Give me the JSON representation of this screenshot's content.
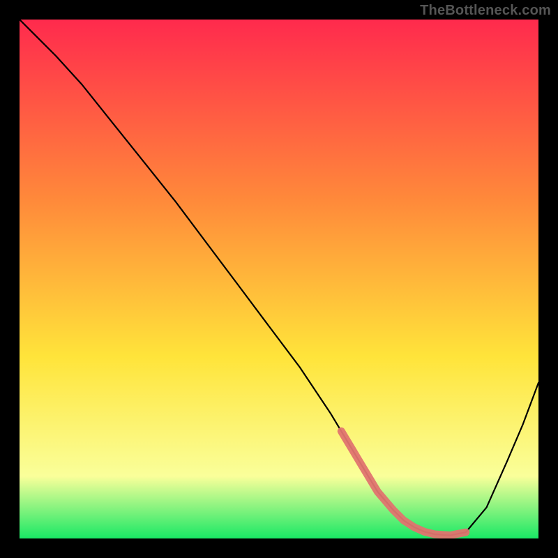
{
  "watermark": "TheBottleneck.com",
  "colors": {
    "gradient_top": "#ff2a4d",
    "gradient_mid1": "#ff8a3a",
    "gradient_mid2": "#ffe43a",
    "gradient_mid3": "#faff9a",
    "gradient_bottom": "#19e865",
    "curve": "#000000",
    "band": "#e0746f"
  },
  "chart_data": {
    "type": "line",
    "title": "",
    "xlabel": "",
    "ylabel": "",
    "xlim": [
      0,
      100
    ],
    "ylim": [
      0,
      100
    ],
    "x": [
      0,
      3,
      7,
      12,
      18,
      24,
      30,
      36,
      42,
      48,
      54,
      60,
      63,
      66,
      69,
      72,
      74,
      76,
      78,
      80,
      83,
      86,
      90,
      94,
      97,
      100
    ],
    "values": [
      100,
      97,
      93,
      87.5,
      80,
      72.5,
      65,
      57,
      49,
      41,
      33,
      24,
      19,
      14,
      9,
      5.5,
      3.5,
      2.2,
      1.3,
      0.8,
      0.6,
      1.2,
      6,
      15,
      22,
      30
    ],
    "optimum_band": {
      "x_start": 62,
      "x_end": 86
    },
    "grid": false,
    "legend": false
  }
}
